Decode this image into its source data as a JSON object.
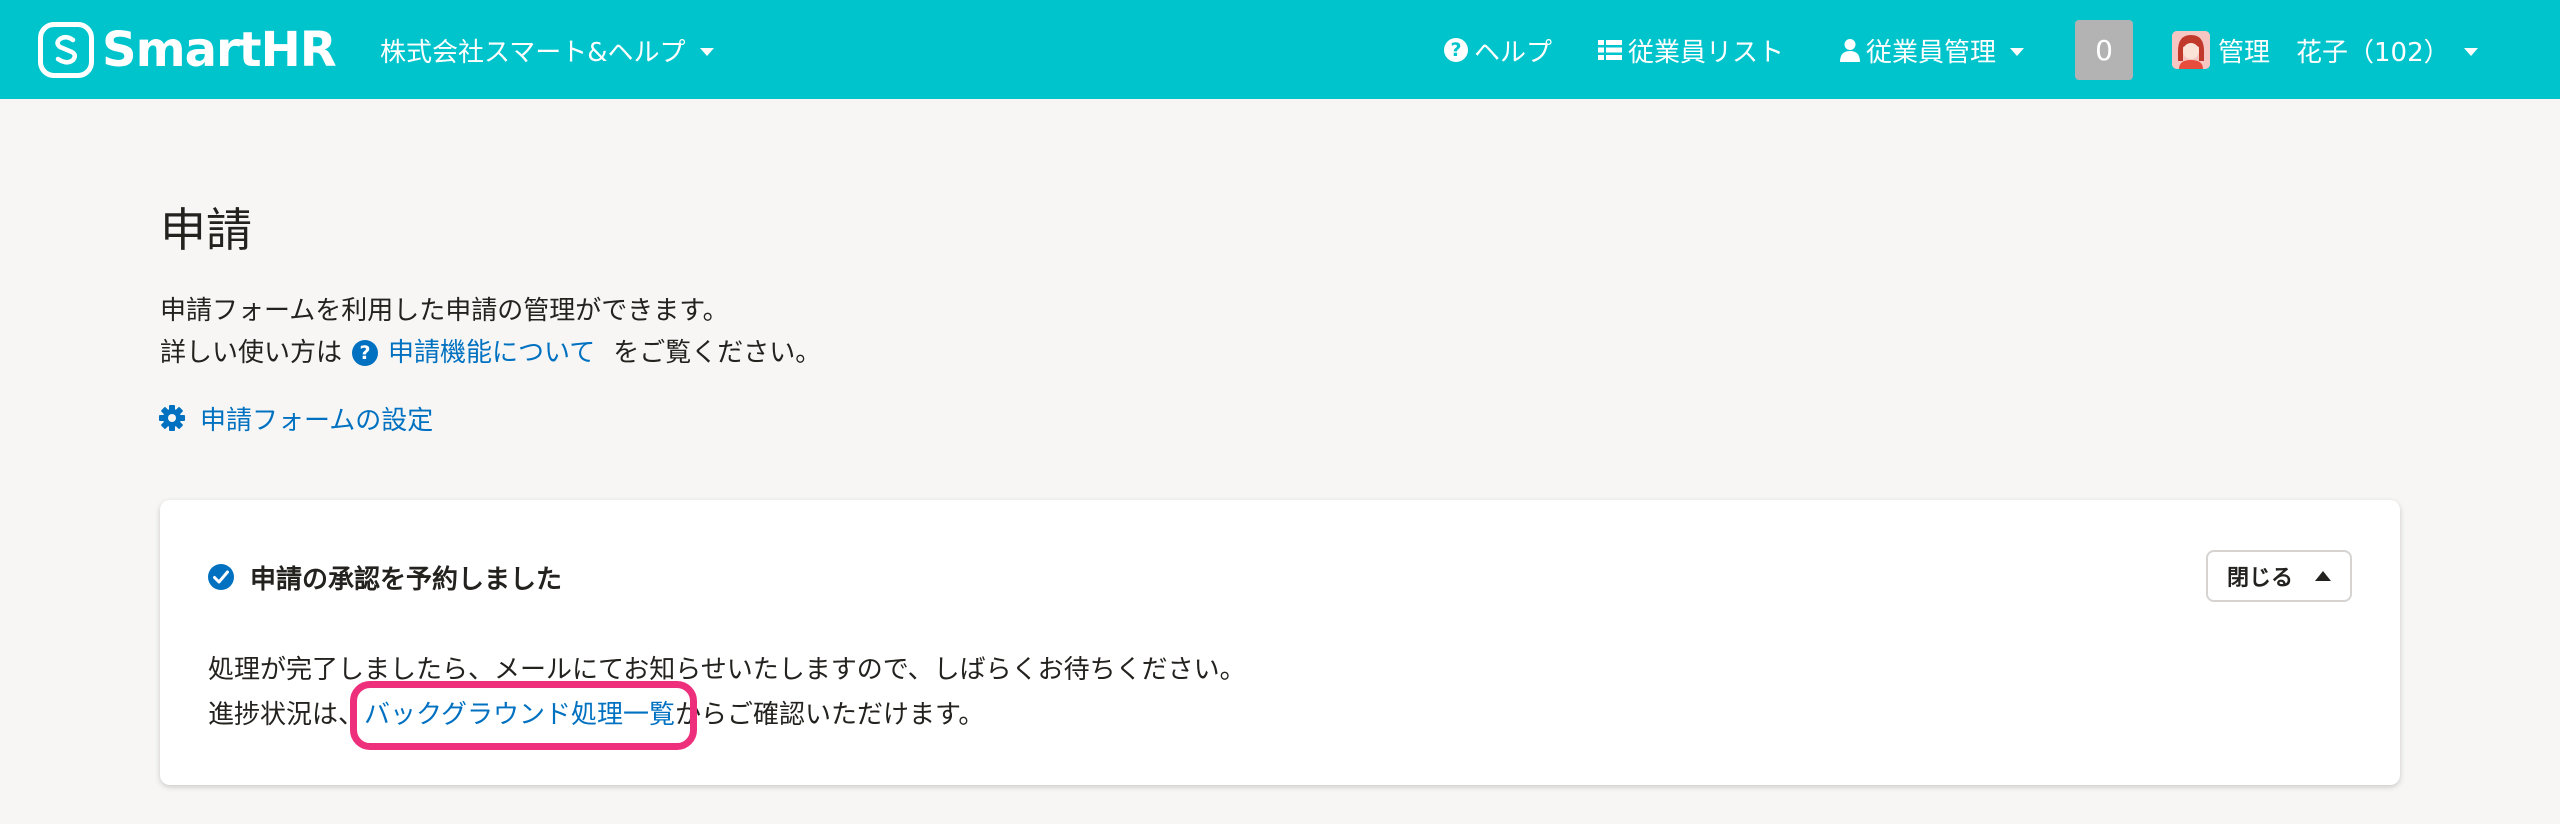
{
  "header": {
    "logo_text": "SmartHR",
    "company_name": "株式会社スマート&ヘルプ",
    "help_label": "ヘルプ",
    "employee_list_label": "従業員リスト",
    "employee_manage_label": "従業員管理",
    "notification_count": "0",
    "user_name": "管理　花子（102）",
    "colors": {
      "bar": "#00c4cc",
      "badge": "#b3b3b3"
    }
  },
  "page": {
    "title": "申請",
    "desc_line1": "申請フォームを利用した申請の管理ができます。",
    "desc_line2_prefix": "詳しい使い方は",
    "help_link": "申請機能について",
    "desc_line2_suffix": "をご覧ください。",
    "settings_link": "申請フォームの設定",
    "link_color": "#0071c1"
  },
  "notice": {
    "title": "申請の承認を予約しました",
    "close_label": "閉じる",
    "body_line1": "処理が完了しましたら、メールにてお知らせいたしますので、しばらくお待ちください。",
    "body_line2_prefix": "進捗状況は、",
    "body_link": "バックグラウンド処理一覧",
    "body_line2_suffix": "からご確認いただけます。",
    "highlight_color": "#ed2f7c"
  }
}
